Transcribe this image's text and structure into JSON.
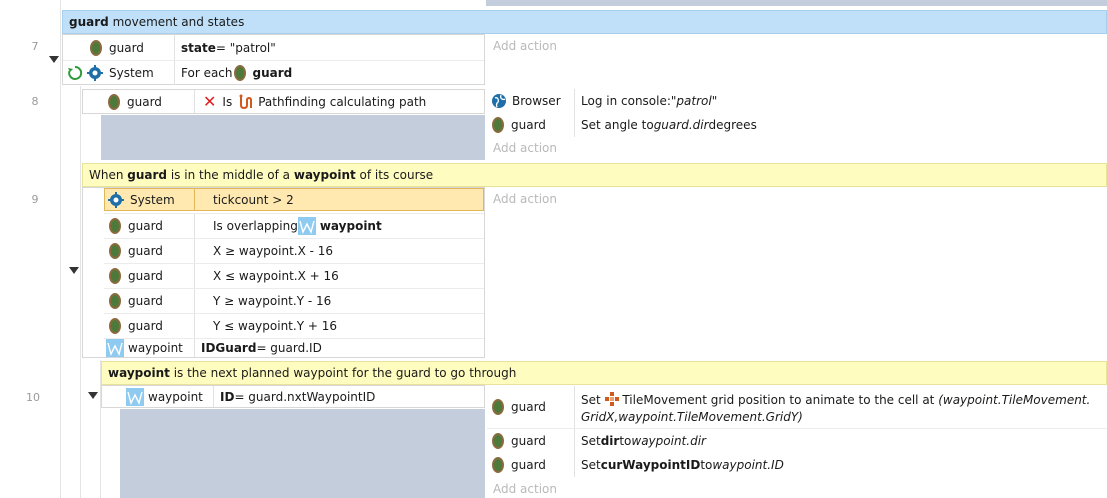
{
  "rows": {
    "r7": "7",
    "r8": "8",
    "r9": "9",
    "r10": "10"
  },
  "group": {
    "name": "guard",
    "title_rest": " movement and states"
  },
  "event7": {
    "cond1_obj": "guard",
    "cond1_bold": "state",
    "cond1_rest": " = \"patrol\"",
    "cond2_obj": "System",
    "cond2_prefix": "For each ",
    "cond2_bold": "guard",
    "add_action": "Add action"
  },
  "event8": {
    "cond_obj": "guard",
    "cond_is": "Is",
    "cond_text": "Pathfinding calculating path",
    "actions": [
      {
        "obj": "Browser",
        "prefix": "Log in console: ",
        "italic": "\"patrol\"",
        "suffix": ""
      },
      {
        "obj": "guard",
        "prefix": "Set angle to ",
        "italic": "guard.dir",
        "suffix": " degrees"
      }
    ],
    "add_action": "Add action"
  },
  "comment9": {
    "p1": "When ",
    "b1": "guard",
    "p2": " is in the middle of a ",
    "b2": "waypoint",
    "p3": " of its course"
  },
  "event9": {
    "conds": [
      {
        "obj": "System",
        "text": "tickcount > 2"
      },
      {
        "obj": "guard",
        "prefix": "Is overlapping ",
        "bold": "waypoint"
      },
      {
        "obj": "guard",
        "text": "X ≥ waypoint.X - 16"
      },
      {
        "obj": "guard",
        "text": "X ≤ waypoint.X + 16"
      },
      {
        "obj": "guard",
        "text": "Y ≥ waypoint.Y - 16"
      },
      {
        "obj": "guard",
        "text": "Y ≤ waypoint.Y + 16"
      },
      {
        "obj": "waypoint",
        "bold": "IDGuard",
        "rest": " = guard.ID"
      }
    ],
    "add_action": "Add action"
  },
  "comment10": {
    "b1": "waypoint",
    "p1": " is the next planned waypoint for the guard to go through"
  },
  "event10": {
    "cond_obj": "waypoint",
    "cond_bold": "ID",
    "cond_rest": " = guard.nxtWaypointID",
    "actions": [
      {
        "obj": "guard",
        "prefix": "Set ",
        "mid": " TileMovement grid position to animate to the cell at ",
        "italic1": "(waypoint.TileMovement.",
        "italic2": "GridX,waypoint.TileMovement.GridY)"
      },
      {
        "obj": "guard",
        "prefix": "Set ",
        "bold": "dir",
        "mid": " to ",
        "italic": "waypoint.dir"
      },
      {
        "obj": "guard",
        "prefix": "Set ",
        "bold": "curWaypointID",
        "mid": " to ",
        "italic": "waypoint.ID"
      }
    ],
    "add_action": "Add action"
  },
  "colors": {
    "comment_blue": "#bfe0f8",
    "comment_yellow": "#fffcc0",
    "selected_condition": "#ffe9b0",
    "collapsed_gray": "#c3cddb",
    "remove_x": "#e02020"
  }
}
